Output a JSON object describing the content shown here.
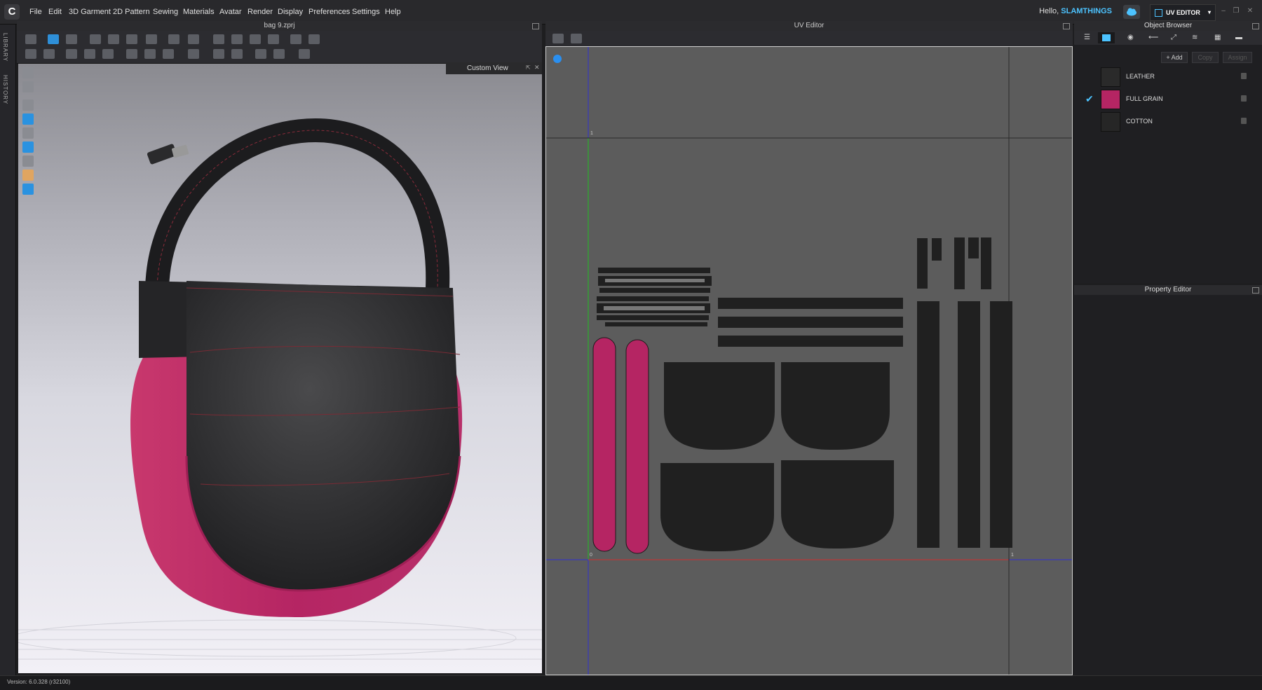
{
  "app": {
    "logo_letter": "C",
    "menu": [
      "File",
      "Edit",
      "3D Garment",
      "2D Pattern",
      "Sewing",
      "Materials",
      "Avatar",
      "Render",
      "Display",
      "Preferences",
      "Settings",
      "Help"
    ],
    "greeting": "Hello,",
    "username": "SLAMTHINGS",
    "mode": "UV EDITOR",
    "window_controls": [
      "–",
      "❐",
      "✕"
    ]
  },
  "left_strip": {
    "tabs": [
      "LIBRARY",
      "HISTORY"
    ]
  },
  "viewport3d": {
    "file_title": "bag 9.zprj",
    "view_label": "Custom View"
  },
  "uv_editor": {
    "title": "UV Editor",
    "axis_labels": [
      "1",
      "0",
      "1"
    ]
  },
  "object_browser": {
    "title": "Object Browser",
    "buttons": {
      "add": "Add",
      "copy": "Copy",
      "assign": "Assign"
    },
    "materials": [
      {
        "name": "LEATHER",
        "color": "#2a2a2a",
        "selected": false
      },
      {
        "name": "FULL GRAIN",
        "color": "#b52563",
        "selected": true
      },
      {
        "name": "COTTON",
        "color": "#262626",
        "selected": false
      }
    ]
  },
  "property_editor": {
    "title": "Property Editor"
  },
  "status": {
    "version": "Version: 6.0.328 (r32100)"
  },
  "colors": {
    "accent": "#4cc3ff",
    "pink": "#b52563",
    "pattern": "#202020"
  }
}
